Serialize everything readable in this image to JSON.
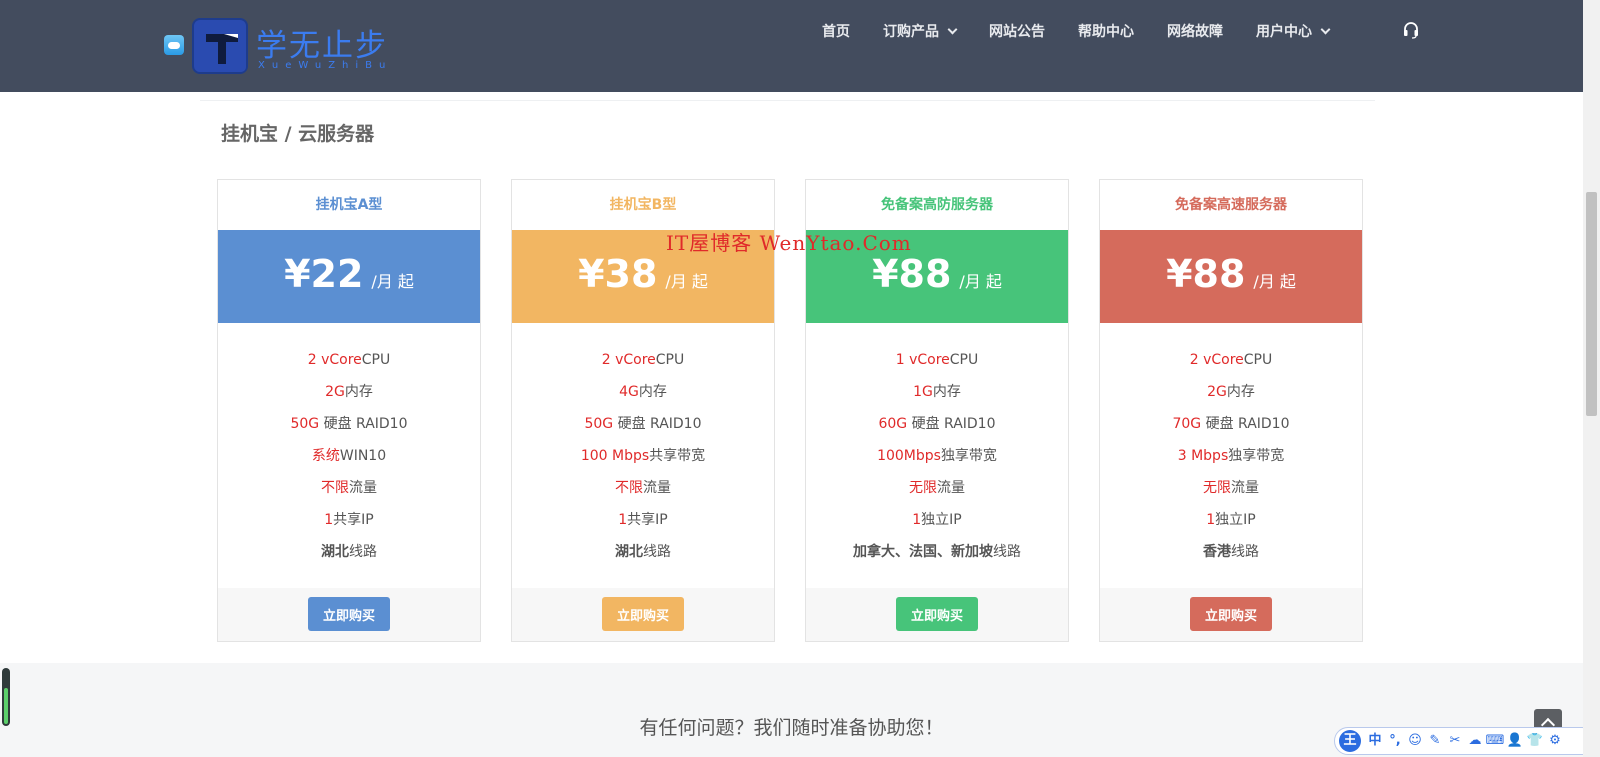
{
  "brand": {
    "name_cn": "学无止步",
    "name_en": "XueWuZhiBu"
  },
  "nav": {
    "items": [
      {
        "label": "首页",
        "dropdown": false
      },
      {
        "label": "订购产品",
        "dropdown": true
      },
      {
        "label": "网站公告",
        "dropdown": false
      },
      {
        "label": "帮助中心",
        "dropdown": false
      },
      {
        "label": "网络故障",
        "dropdown": false
      },
      {
        "label": "用户中心",
        "dropdown": true
      }
    ],
    "support_icon": "headset-icon"
  },
  "page": {
    "title": "挂机宝 / 云服务器",
    "watermark": "IT屋博客 WenYtao.Com",
    "help_text": "有任何问题？我们随时准备协助您！"
  },
  "colors": {
    "header_bg": "#434c5e",
    "blue": "#5b8fd2",
    "orange": "#f2b662",
    "green": "#47c47a",
    "red": "#d56b5c",
    "highlight": "#e02a2a"
  },
  "plans": [
    {
      "name": "挂机宝A型",
      "price": "¥22",
      "unit": "/月 起",
      "color": "#5b8fd2",
      "features": [
        {
          "hl": "2 vCore",
          "rest": "CPU"
        },
        {
          "hl": "2G",
          "rest": "内存"
        },
        {
          "hl": "50G",
          "rest": " 硬盘 RAID10"
        },
        {
          "hl": "系统",
          "rest": "WIN10"
        },
        {
          "hl": "不限",
          "rest": "流量"
        },
        {
          "hl": "1",
          "rest": "共享IP"
        },
        {
          "bold": "湖北",
          "rest": "线路"
        }
      ],
      "buy_label": "立即购买"
    },
    {
      "name": "挂机宝B型",
      "price": "¥38",
      "unit": "/月 起",
      "color": "#f2b662",
      "features": [
        {
          "hl": "2 vCore",
          "rest": "CPU"
        },
        {
          "hl": "4G",
          "rest": "内存"
        },
        {
          "hl": "50G",
          "rest": " 硬盘 RAID10"
        },
        {
          "hl": "100 Mbps",
          "rest": "共享带宽"
        },
        {
          "hl": "不限",
          "rest": "流量"
        },
        {
          "hl": "1",
          "rest": "共享IP"
        },
        {
          "bold": "湖北",
          "rest": "线路"
        }
      ],
      "buy_label": "立即购买"
    },
    {
      "name": "免备案高防服务器",
      "price": "¥88",
      "unit": "/月 起",
      "color": "#47c47a",
      "features": [
        {
          "hl": "1 vCore",
          "rest": "CPU"
        },
        {
          "hl": "1G",
          "rest": "内存"
        },
        {
          "hl": "60G",
          "rest": " 硬盘 RAID10"
        },
        {
          "hl": "100Mbps",
          "rest": "独享带宽"
        },
        {
          "hl": "无限",
          "rest": "流量"
        },
        {
          "hl": "1",
          "rest": "独立IP"
        },
        {
          "bold": "加拿大、法国、新加坡",
          "rest": "线路"
        }
      ],
      "buy_label": "立即购买"
    },
    {
      "name": "免备案高速服务器",
      "price": "¥88",
      "unit": "/月 起",
      "color": "#d56b5c",
      "features": [
        {
          "hl": "2 vCore",
          "rest": "CPU"
        },
        {
          "hl": "2G",
          "rest": "内存"
        },
        {
          "hl": "70G",
          "rest": " 硬盘 RAID10"
        },
        {
          "hl": "3 Mbps",
          "rest": "独享带宽"
        },
        {
          "hl": "无限",
          "rest": "流量"
        },
        {
          "hl": "1",
          "rest": "独立IP"
        },
        {
          "bold": "香港",
          "rest": "线路"
        }
      ],
      "buy_label": "立即购买"
    }
  ],
  "ime": {
    "logo": "王",
    "items": [
      "中",
      "°,",
      "☺",
      "✎",
      "✂",
      "☁",
      "⌨",
      "👤",
      "👕",
      "⚙"
    ]
  }
}
